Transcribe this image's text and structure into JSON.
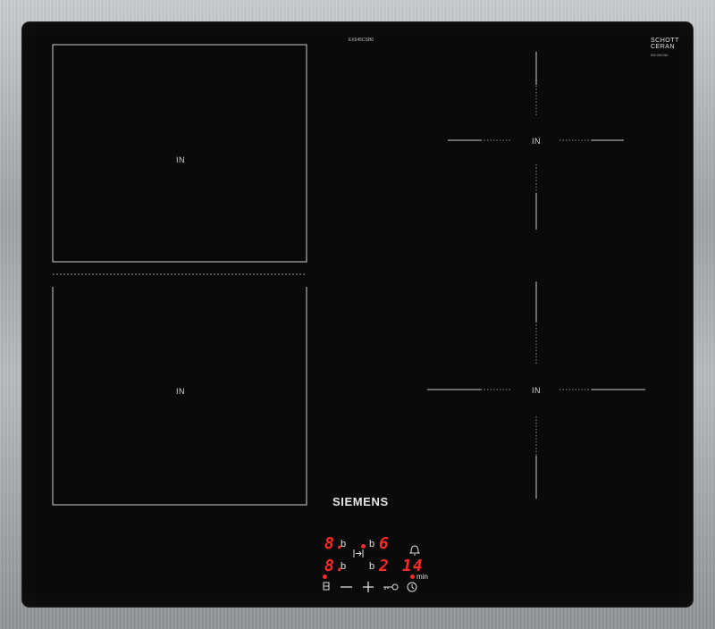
{
  "cooktop": {
    "model_code": "EX645CSB6",
    "glass_brand_line1": "SCHOTT",
    "glass_brand_line2": "CERAN",
    "glass_brand_sub": "800.060.060",
    "brand": "SIEMENS",
    "zone_label": "IN",
    "colors": {
      "glass": "#0a0a0a",
      "display": "#ff2a2a",
      "frame": "#a7aaad"
    }
  },
  "display": {
    "zone_front_left_level": "8.",
    "zone_front_right_level": "6",
    "zone_rear_left_level": "8.",
    "zone_rear_right_level": "2",
    "boost_symbol": "b",
    "timer_value": "14",
    "timer_unit": "min"
  },
  "controls": {
    "minus_label": "—",
    "plus_label": "+",
    "key_icon": "key-icon",
    "clock_icon": "clock-icon",
    "bell_icon": "bell-icon",
    "pause_icon": "pause-icon",
    "lock_icon": "lock-icon"
  }
}
